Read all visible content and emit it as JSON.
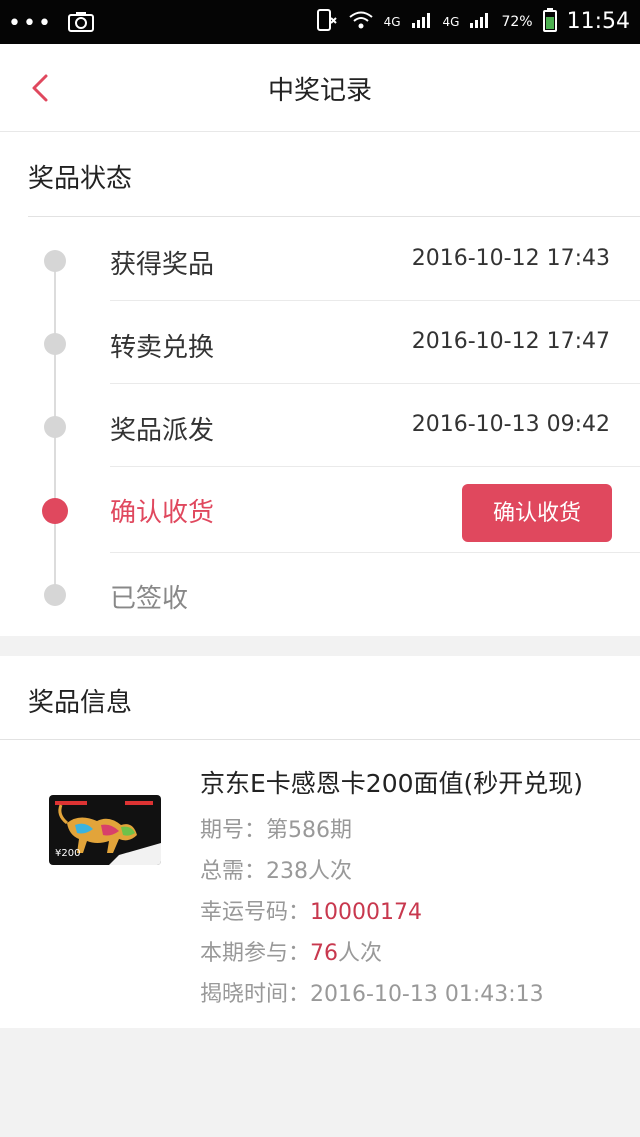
{
  "status_bar": {
    "dots": "•••",
    "network_1": "4G",
    "network_2": "4G",
    "battery_percent": "72%",
    "time": "11:54"
  },
  "header": {
    "title": "中奖记录"
  },
  "status_section": {
    "title": "奖品状态",
    "steps": [
      {
        "label": "获得奖品",
        "time": "2016-10-12 17:43"
      },
      {
        "label": "转卖兑换",
        "time": "2016-10-12 17:47"
      },
      {
        "label": "奖品派发",
        "time": "2016-10-13 09:42"
      },
      {
        "label": "确认收货",
        "button": "确认收货"
      },
      {
        "label": "已签收"
      }
    ]
  },
  "info_section": {
    "title": "奖品信息",
    "prize_name": "京东E卡感恩卡200面值(秒开兑现)",
    "thumb_price": "¥200",
    "period_label": "期号：",
    "period_value": "第586期",
    "total_label": "总需：",
    "total_value": "238人次",
    "lucky_label": "幸运号码：",
    "lucky_value": "10000174",
    "participate_label": "本期参与：",
    "participate_value": "76",
    "participate_unit": "人次",
    "reveal_label": "揭晓时间：",
    "reveal_value": "2016-10-13 01:43:13"
  },
  "colors": {
    "accent": "#e0485e",
    "highlight_text": "#c8384e",
    "inactive_dot": "#d6d6d6"
  }
}
